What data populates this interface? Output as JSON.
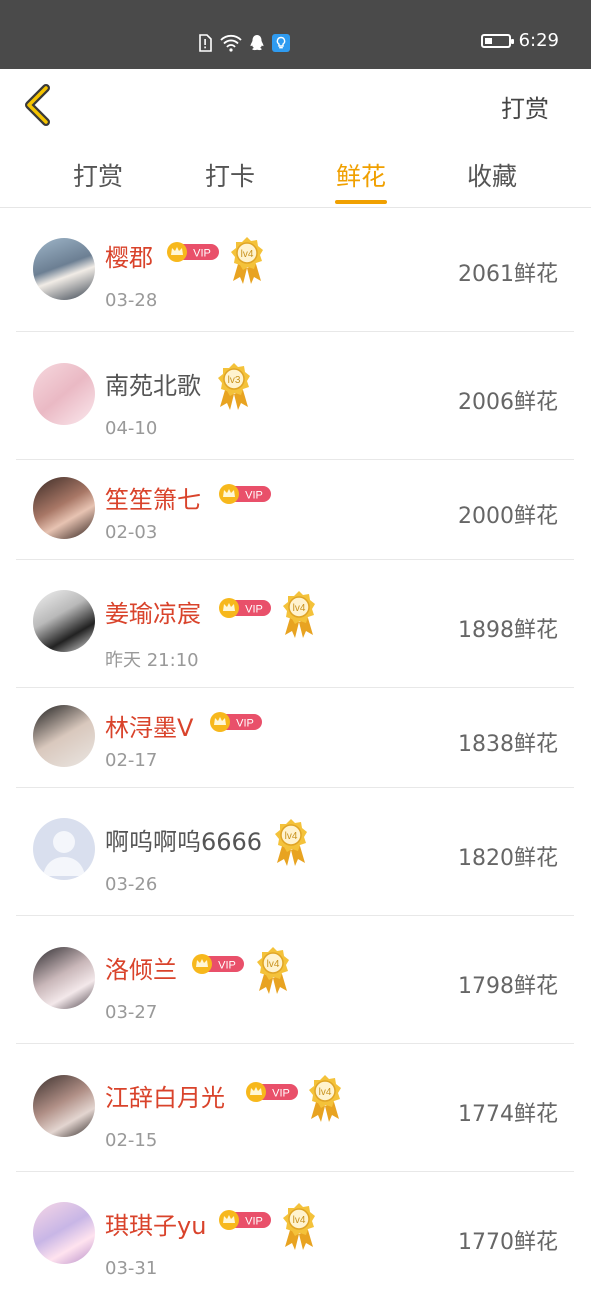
{
  "status_bar": {
    "time": "6:29",
    "battery_level": 0.35,
    "icons": [
      "sim-alert-icon",
      "wifi-icon",
      "qq-icon",
      "bulb-app-icon"
    ]
  },
  "header": {
    "action_label": "打赏"
  },
  "tabs": [
    {
      "label": "打赏",
      "active": false
    },
    {
      "label": "打卡",
      "active": false
    },
    {
      "label": "鲜花",
      "active": true
    },
    {
      "label": "收藏",
      "active": false
    }
  ],
  "accent_color": "#f0a000",
  "vip_name_color": "#d9432b",
  "vip_badge_text": "VIP",
  "medal_text": {
    "lv4": "lv4",
    "lv3": "lv3"
  },
  "rows": [
    {
      "name": "樱郡",
      "date": "03-28",
      "amount": "2061鲜花",
      "vip": true,
      "level": "lv4"
    },
    {
      "name": "南苑北歌",
      "date": "04-10",
      "amount": "2006鲜花",
      "vip": false,
      "level": "lv3"
    },
    {
      "name": "笙笙箫七",
      "date": "02-03",
      "amount": "2000鲜花",
      "vip": true,
      "level": ""
    },
    {
      "name": "姜瑜凉宸",
      "date": "昨天 21:10",
      "amount": "1898鲜花",
      "vip": true,
      "level": "lv4"
    },
    {
      "name": "林浔墨V",
      "date": "02-17",
      "amount": "1838鲜花",
      "vip": true,
      "level": ""
    },
    {
      "name": "啊呜啊呜6666",
      "date": "03-26",
      "amount": "1820鲜花",
      "vip": false,
      "level": "lv4"
    },
    {
      "name": "洛倾兰",
      "date": "03-27",
      "amount": "1798鲜花",
      "vip": true,
      "level": "lv4"
    },
    {
      "name": "江辞白月光",
      "date": "02-15",
      "amount": "1774鲜花",
      "vip": true,
      "level": "lv4"
    },
    {
      "name": "琪琪子yu",
      "date": "03-31",
      "amount": "1770鲜花",
      "vip": true,
      "level": "lv4"
    }
  ]
}
